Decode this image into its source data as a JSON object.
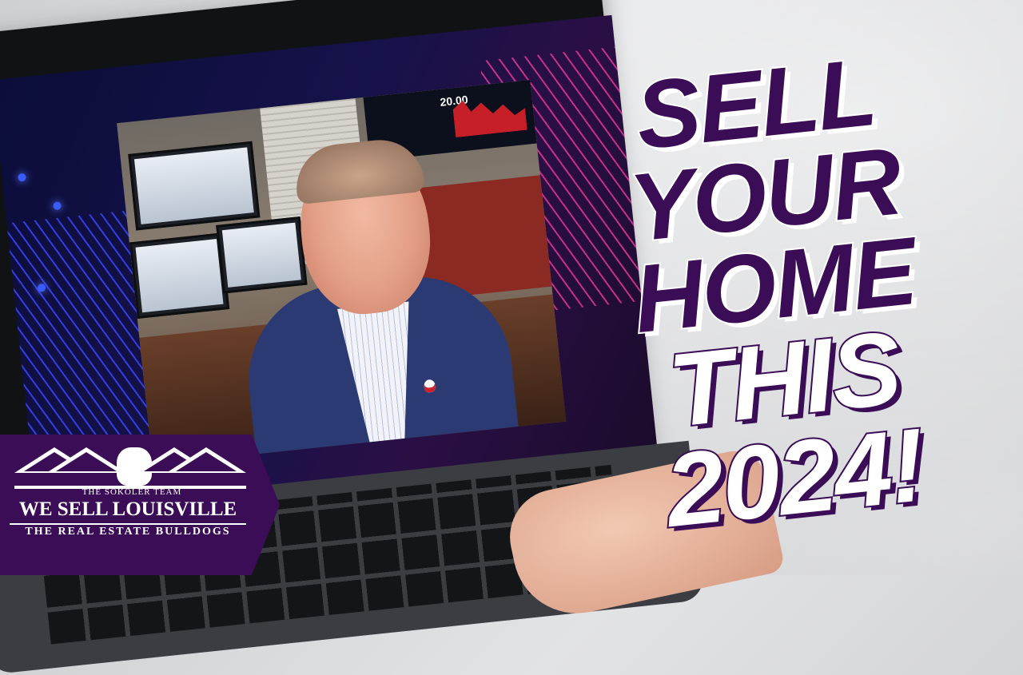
{
  "headline": {
    "line1": "SELL YOUR",
    "line2": "HOME",
    "line3": "THIS 2024!"
  },
  "logo": {
    "team_label": "THE SOKOLER TEAM",
    "brand_name": "WE SELL LOUISVILLE",
    "tagline": "THE REAL ESTATE BULLDOGS"
  },
  "tv_ticker": {
    "value": "20.00"
  },
  "colors": {
    "brand_purple": "#3a0d56",
    "headline_white": "#ffffff",
    "accent_blue": "#3b46ff",
    "accent_pink": "#ff3aa0"
  }
}
